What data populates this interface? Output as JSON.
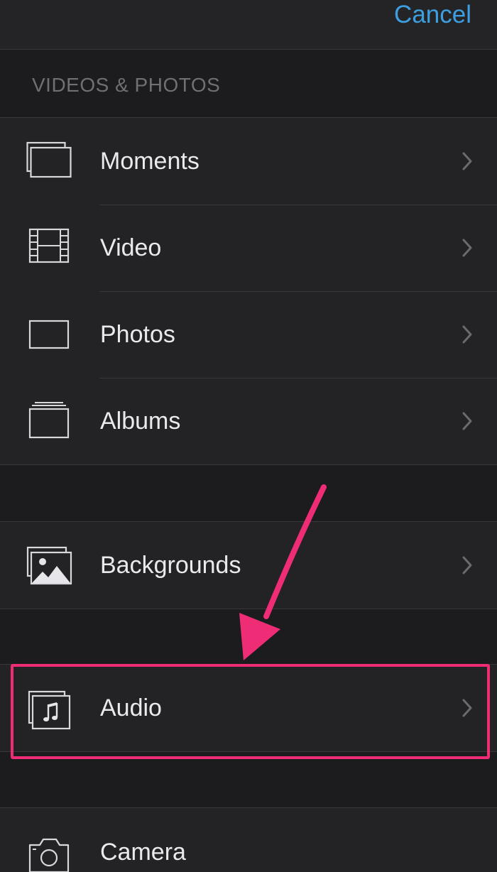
{
  "header": {
    "cancel_label": "Cancel"
  },
  "videos_photos": {
    "title": "VIDEOS & PHOTOS",
    "items": [
      {
        "label": "Moments",
        "icon": "moments-icon"
      },
      {
        "label": "Video",
        "icon": "film-icon"
      },
      {
        "label": "Photos",
        "icon": "photo-frame-icon"
      },
      {
        "label": "Albums",
        "icon": "albums-icon"
      }
    ]
  },
  "backgrounds": {
    "label": "Backgrounds",
    "icon": "landscape-image-icon"
  },
  "audio": {
    "label": "Audio",
    "icon": "music-note-icon",
    "highlighted": true
  },
  "camera": {
    "label": "Camera",
    "icon": "camera-icon"
  },
  "colors": {
    "accent": "#3c9fe0",
    "annotation": "#ee2d76",
    "background": "#1c1c1e"
  }
}
